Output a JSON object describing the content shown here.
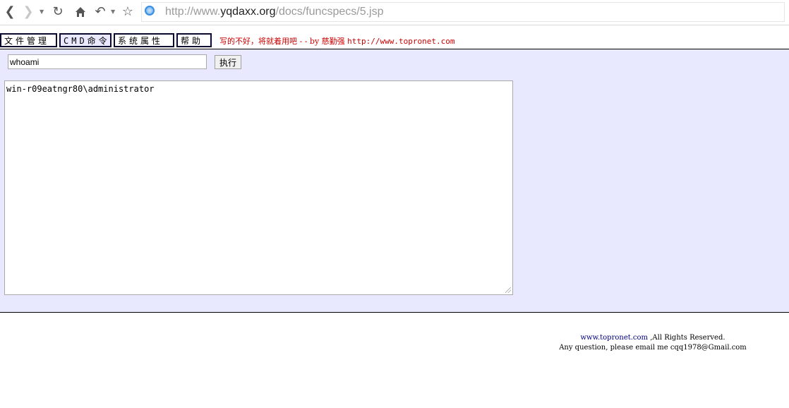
{
  "browser": {
    "url_scheme": "http://www.",
    "url_host": "yqdaxx.org",
    "url_path": "/docs/funcspecs/5.jsp",
    "icons": [
      "back-icon",
      "forward-icon",
      "reload-icon",
      "home-icon",
      "undo-icon",
      "star-icon",
      "site-icon"
    ]
  },
  "menu": {
    "items": [
      {
        "label": "文件管理"
      },
      {
        "label": "CMD命令"
      },
      {
        "label": "系统属性"
      },
      {
        "label": "帮助"
      }
    ],
    "tagline_text": "写的不好，将就着用吧 - - by 慈勤强 ",
    "tagline_url": "http://www.topronet.com",
    "tagline_color": "#cc0000"
  },
  "command": {
    "input_value": "whoami",
    "exec_label": "执行",
    "output": "win-r09eatngr80\\administrator"
  },
  "panel_color": "#e8e8ff",
  "footer": {
    "site_link": "www.topronet.com",
    "rights": " ,All Rights Reserved.",
    "contact": "Any question, please email me cqq1978@Gmail.com"
  }
}
